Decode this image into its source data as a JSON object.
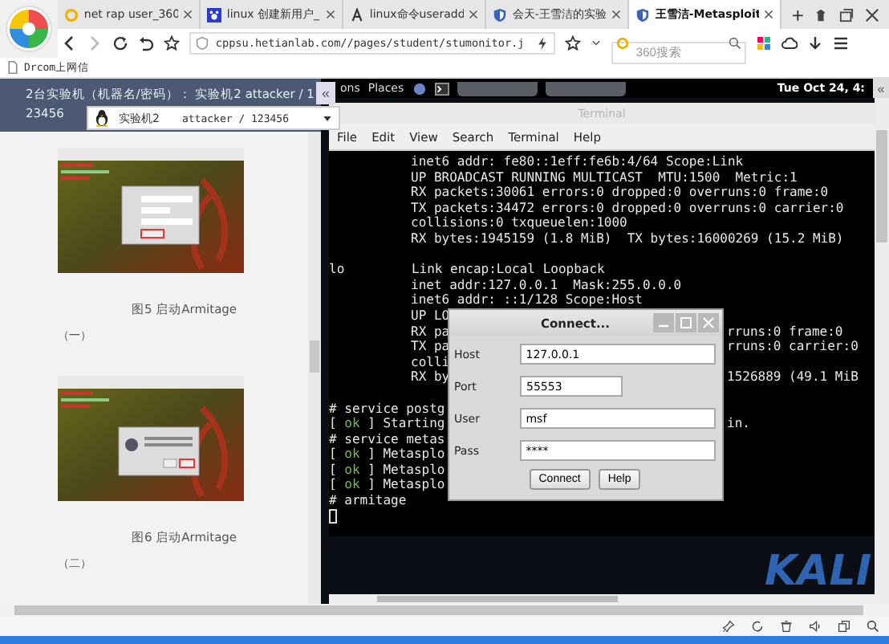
{
  "browser": {
    "tabs": [
      {
        "title": "net rap user_360",
        "selected": false
      },
      {
        "title": "linux 创建新用户_",
        "selected": false
      },
      {
        "title": "linux命令useradd",
        "selected": false
      },
      {
        "title": "会天-王雪洁的实验",
        "selected": false
      },
      {
        "title": "王雪洁-Metasploit",
        "selected": true
      }
    ],
    "new_tab": "+",
    "address": "cppsu.hetianlab.com//pages/student/stumonitor.j",
    "search": {
      "placeholder": "360搜索"
    },
    "bookmarks": [
      "Drcom上网信"
    ]
  },
  "sidebar": {
    "header_lines": [
      "2台实验机（机器名/密码）： 实验机2 attacker / 1",
      "23456"
    ],
    "collapse": "«",
    "machine_select": {
      "name": "实验机2",
      "value": "attacker / 123456"
    },
    "figures": [
      {
        "caption": "图5 启动Armitage",
        "subcaption": "（一）",
        "kind": "connect"
      },
      {
        "caption": "图6 启动Armitage",
        "subcaption": "（二）",
        "kind": "prompt"
      }
    ]
  },
  "desktop": {
    "top_bar": {
      "menu": [
        "ons",
        "Places"
      ],
      "clock": "Tue Oct 24, 4:",
      "expand": "«"
    },
    "wallpaper_text": "KALI"
  },
  "terminal": {
    "title": "Terminal",
    "menu": [
      "File",
      "Edit",
      "View",
      "Search",
      "Terminal",
      "Help"
    ],
    "lines": [
      {
        "kind": "indented",
        "text": "inet6 addr: fe80::1eff:fe6b:4/64 Scope:Link"
      },
      {
        "kind": "indented",
        "text": "UP BROADCAST RUNNING MULTICAST  MTU:1500  Metric:1"
      },
      {
        "kind": "indented",
        "text": "RX packets:30061 errors:0 dropped:0 overruns:0 frame:0"
      },
      {
        "kind": "indented",
        "text": "TX packets:34472 errors:0 dropped:0 overruns:0 carrier:0"
      },
      {
        "kind": "indented",
        "text": "collisions:0 txqueuelen:1000"
      },
      {
        "kind": "indented",
        "text": "RX bytes:1945159 (1.8 MiB)  TX bytes:16000269 (15.2 MiB)"
      },
      {
        "kind": "blank"
      },
      {
        "kind": "labeled",
        "label": "lo",
        "text": "Link encap:Local Loopback"
      },
      {
        "kind": "indented",
        "text": "inet addr:127.0.0.1  Mask:255.0.0.0"
      },
      {
        "kind": "indented",
        "text": "inet6 addr: ::1/128 Scope:Host"
      },
      {
        "kind": "indented",
        "text": "UP LO"
      },
      {
        "kind": "indented",
        "text": "RX pa",
        "tail": "rruns:0 frame:0"
      },
      {
        "kind": "indented",
        "text": "TX pa",
        "tail": "rruns:0 carrier:0"
      },
      {
        "kind": "indented",
        "text": "colli"
      },
      {
        "kind": "indented",
        "text": "RX by",
        "tail": "1526889 (49.1 MiB"
      },
      {
        "kind": "blank"
      },
      {
        "kind": "plain",
        "text": "# service postg"
      },
      {
        "kind": "status",
        "open": "[",
        "status": "ok",
        "close": "]",
        "text": "Starting",
        "tail": "in."
      },
      {
        "kind": "plain",
        "text": "# service metas"
      },
      {
        "kind": "status",
        "open": "[",
        "status": "ok",
        "close": "]",
        "text": "Metasplo"
      },
      {
        "kind": "status",
        "open": "[",
        "status": "ok",
        "close": "]",
        "text": "Metasplo"
      },
      {
        "kind": "status",
        "open": "[",
        "status": "ok",
        "close": "]",
        "text": "Metasplo"
      },
      {
        "kind": "plain",
        "text": "# armitage"
      },
      {
        "kind": "cursor"
      }
    ]
  },
  "dialog": {
    "title": "Connect...",
    "fields": [
      {
        "label": "Host",
        "value": "127.0.0.1",
        "kind": "wide"
      },
      {
        "label": "Port",
        "value": "55553",
        "kind": "short"
      },
      {
        "label": "User",
        "value": "msf",
        "kind": "wide"
      },
      {
        "label": "Pass",
        "value": "****",
        "kind": "wide"
      }
    ],
    "buttons": [
      "Connect",
      "Help"
    ]
  }
}
